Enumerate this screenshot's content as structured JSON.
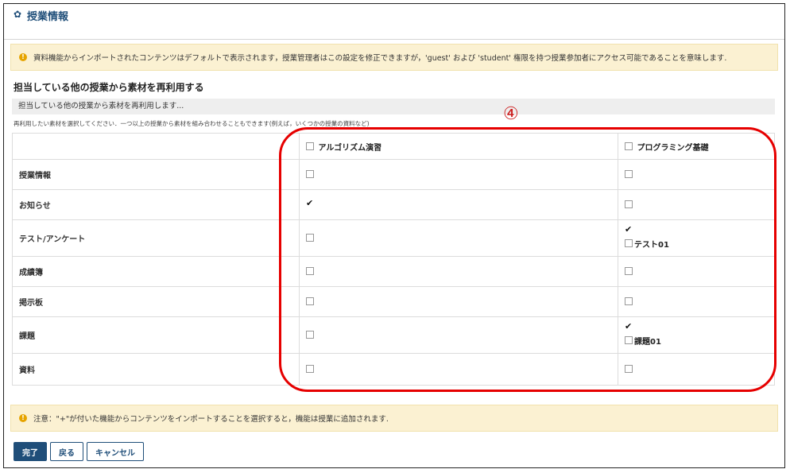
{
  "header": {
    "title": "授業情報"
  },
  "alerts": {
    "top": "資料機能からインポートされたコンテンツはデフォルトで表示されます，授業管理者はこの設定を修正できますが，'guest' および 'student' 権限を持つ授業参加者にアクセス可能であることを意味します.",
    "bottom": "注意：\"+\"が付いた機能からコンテンツをインポートすることを選択すると，機能は授業に追加されます."
  },
  "section": {
    "title": "担当している他の授業から素材を再利用する",
    "subtitle": "担当している他の授業から素材を再利用します...",
    "hint": "再利用したい素材を選択してください．一つ以上の授業から素材を組み合わせることもできます(例えば，いくつかの授業の資料など)"
  },
  "annotation_number": "④",
  "table": {
    "columns": [
      {
        "label": "アルゴリズム演習",
        "checked": false
      },
      {
        "label": "プログラミング基礎",
        "checked": false
      }
    ],
    "rows": [
      {
        "label": "授業情報",
        "col1": {
          "checked": false
        },
        "col2": {
          "checked": false
        }
      },
      {
        "label": "お知らせ",
        "col1": {
          "checked": true
        },
        "col2": {
          "checked": false
        }
      },
      {
        "label": "テスト/アンケート",
        "col1": {
          "checked": false
        },
        "col2": {
          "checked": true,
          "sub": "テスト01",
          "sub_checked": false
        }
      },
      {
        "label": "成績簿",
        "col1": {
          "checked": false
        },
        "col2": {
          "checked": false
        }
      },
      {
        "label": "掲示板",
        "col1": {
          "checked": false
        },
        "col2": {
          "checked": false
        }
      },
      {
        "label": "課題",
        "col1": {
          "checked": false
        },
        "col2": {
          "checked": true,
          "sub": "課題01",
          "sub_checked": false
        }
      },
      {
        "label": "資料",
        "col1": {
          "checked": false
        },
        "col2": {
          "checked": false
        }
      }
    ]
  },
  "buttons": {
    "done": "完了",
    "back": "戻る",
    "cancel": "キャンセル"
  }
}
